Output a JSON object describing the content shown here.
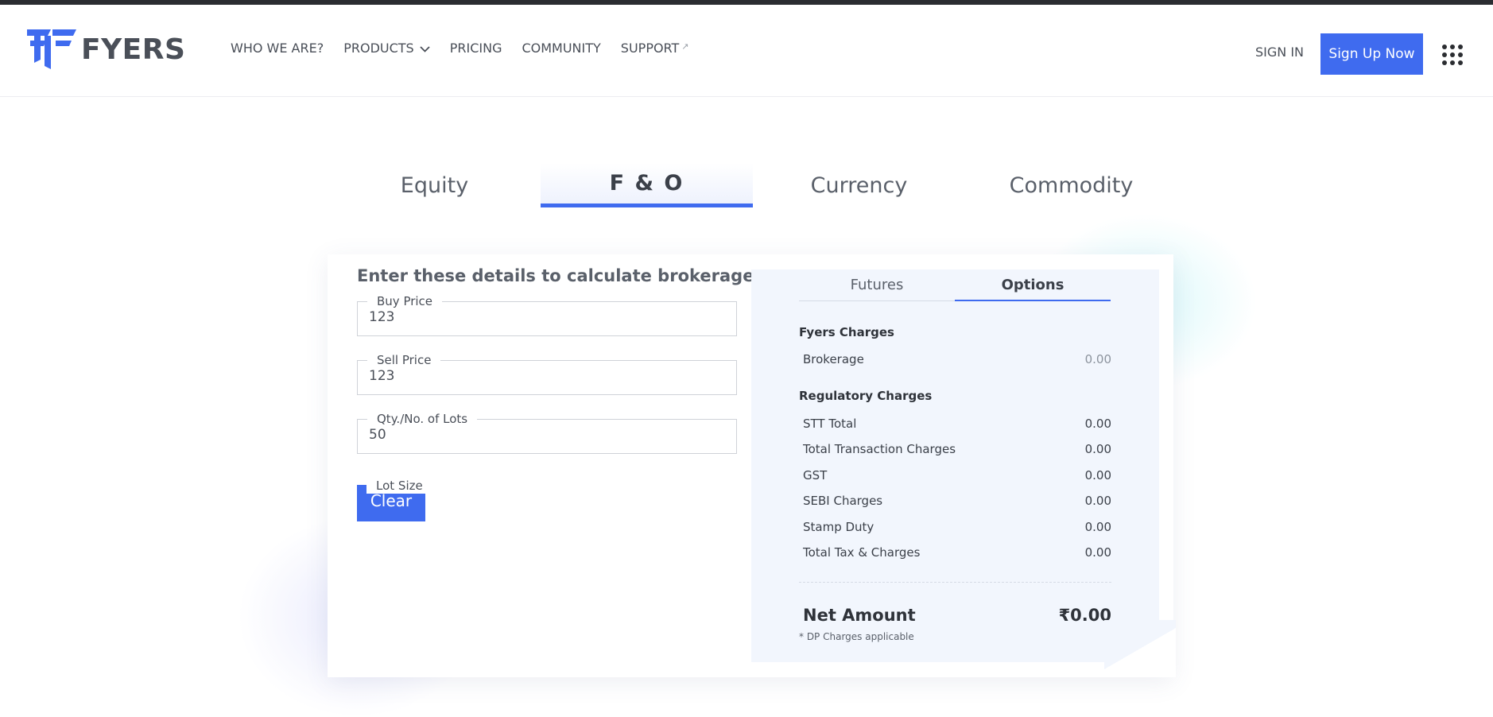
{
  "brand": {
    "name": "FYERS"
  },
  "nav": {
    "items": [
      {
        "label": "WHO WE ARE?"
      },
      {
        "label": "PRODUCTS"
      },
      {
        "label": "PRICING"
      },
      {
        "label": "COMMUNITY"
      },
      {
        "label": "SUPPORT"
      }
    ],
    "sign_in": "SIGN IN",
    "sign_up": "Sign Up Now",
    "icons": {
      "products": "chevron-down-icon",
      "support": "external-link-icon",
      "menu": "grid-menu-icon"
    }
  },
  "segment_tabs": [
    {
      "label": "Equity",
      "active": false
    },
    {
      "label": "F & O",
      "active": true
    },
    {
      "label": "Currency",
      "active": false
    },
    {
      "label": "Commodity",
      "active": false
    }
  ],
  "form": {
    "title": "Enter these details to calculate brokerage",
    "buy_price": {
      "label": "Buy Price",
      "value": "123"
    },
    "sell_price": {
      "label": "Sell Price",
      "value": "123"
    },
    "qty": {
      "label": "Qty./No. of Lots",
      "value": "50"
    },
    "lot_size": {
      "label": "Lot Size"
    },
    "clear_label": "Clear"
  },
  "results": {
    "subtabs": [
      {
        "label": "Futures",
        "active": false
      },
      {
        "label": "Options",
        "active": true
      }
    ],
    "fyers_title": "Fyers Charges",
    "brokerage": {
      "label": "Brokerage",
      "value": "0.00"
    },
    "regulatory_title": "Regulatory Charges",
    "regulatory": [
      {
        "label": "STT Total",
        "value": "0.00"
      },
      {
        "label": "Total Transaction Charges",
        "value": "0.00"
      },
      {
        "label": "GST",
        "value": "0.00"
      },
      {
        "label": "SEBI Charges",
        "value": "0.00"
      },
      {
        "label": "Stamp Duty",
        "value": "0.00"
      },
      {
        "label": "Total Tax & Charges",
        "value": "0.00"
      }
    ],
    "net_label": "Net Amount",
    "net_value": "₹0.00",
    "note": "* DP Charges applicable"
  },
  "colors": {
    "accent": "#3f6bef",
    "panel": "#f2f6fd",
    "text": "#3b4049"
  }
}
